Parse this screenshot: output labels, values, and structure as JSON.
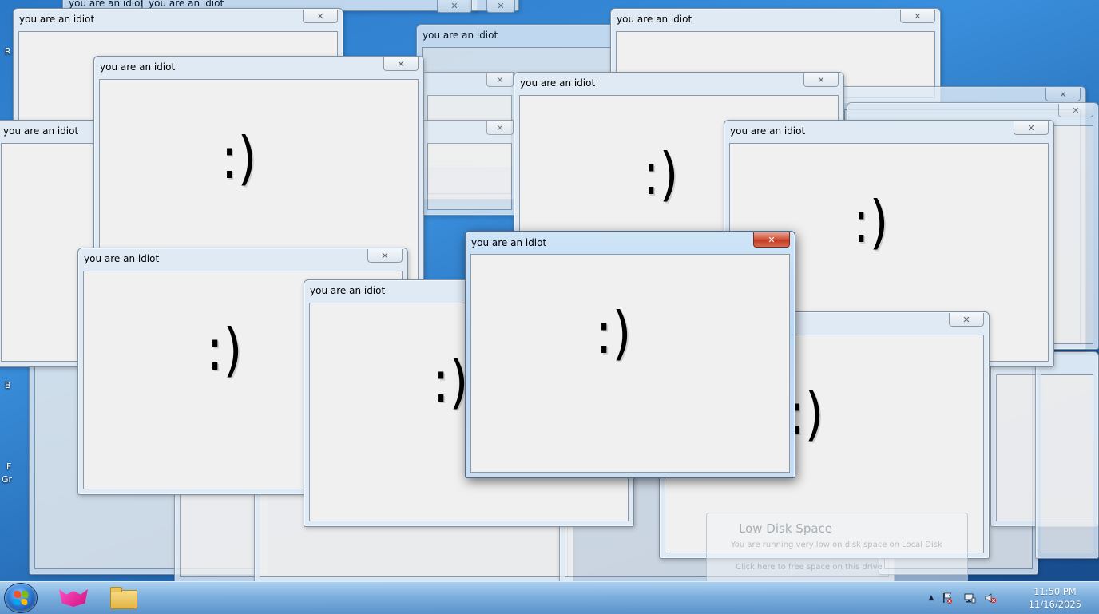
{
  "window_title": "you are an idiot",
  "close_glyph": "✕",
  "smiley": ":)",
  "desktop_fragments": [
    "R",
    "B",
    "F",
    "Gr"
  ],
  "balloon": {
    "title": "Low Disk Space",
    "text": "You are running very low on disk space on Local Disk",
    "link": "Click here to free space on this drive"
  },
  "taskbar": {
    "apps": [
      {
        "name": "start-button-icon"
      },
      {
        "name": "pinned-app-fox-icon"
      },
      {
        "name": "file-explorer-folder-icon"
      }
    ],
    "tray": {
      "chevron": "▲",
      "time": "11:50 PM",
      "date": "11/16/2025"
    }
  },
  "colors": {
    "active_close": "#c23a22",
    "client_bg": "#f0f0f0",
    "desktop_blue": "#2a78c7"
  }
}
